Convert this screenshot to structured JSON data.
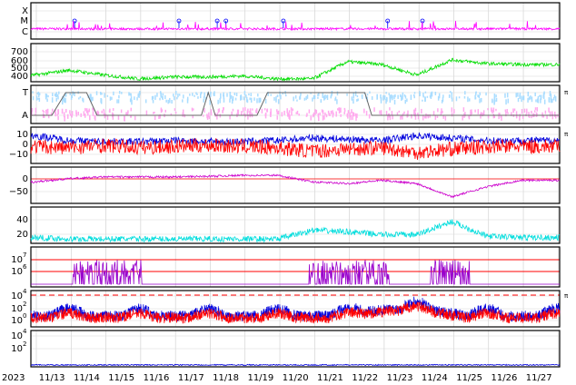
{
  "chart_data": {
    "type": "line",
    "x": [
      "11/13",
      "11/14",
      "11/15",
      "11/16",
      "11/17",
      "11/18",
      "11/19",
      "11/20",
      "11/21",
      "11/22",
      "11/23",
      "11/24",
      "11/25",
      "11/26",
      "11/27"
    ],
    "year_label": "2023",
    "panels": [
      {
        "id": "flare",
        "ytick_labels": [
          "X",
          "M",
          "C"
        ],
        "series": [
          {
            "color": "#ff00ff",
            "level": "C"
          }
        ],
        "markers": {
          "color": "#0000ff",
          "at": [
            "11/14",
            "11/17",
            "11/18",
            "11/18",
            "11/20",
            "11/23",
            "11/24"
          ]
        }
      },
      {
        "id": "solar-wind-speed",
        "ytick_labels": [
          "700",
          "600",
          "500",
          "400"
        ],
        "ylim": [
          350,
          750
        ],
        "series": [
          {
            "color": "#00dd00",
            "values": [
              420,
              470,
              420,
              380,
              400,
              400,
              410,
              380,
              380,
              560,
              530,
              420,
              580,
              540,
              530
            ]
          }
        ]
      },
      {
        "id": "sector",
        "ytick_labels": [
          "T",
          "A"
        ],
        "right_label": "π",
        "series": [
          {
            "color": "#aaddff",
            "name": ""
          },
          {
            "color": "#ffaaee",
            "name": ""
          },
          {
            "color": "#666666",
            "name": ""
          }
        ]
      },
      {
        "id": "imf",
        "ytick_labels": [
          "10",
          "0",
          "−10"
        ],
        "ylim": [
          -15,
          15
        ],
        "right_label": "π",
        "series": [
          {
            "color": "#0000dd",
            "values": [
              8,
              4,
              3,
              3,
              4,
              3,
              3,
              4,
              6,
              5,
              4,
              8,
              6,
              4,
              4
            ]
          },
          {
            "color": "#ff0000",
            "values": [
              -1,
              -2,
              0,
              -2,
              -1,
              0,
              -1,
              -2,
              -5,
              -3,
              -2,
              -6,
              -3,
              -1,
              -1
            ]
          }
        ]
      },
      {
        "id": "dst",
        "ytick_labels": [
          "0",
          "−50"
        ],
        "ylim": [
          -90,
          20
        ],
        "series": [
          {
            "color": "#cc00cc",
            "values": [
              -25,
              -15,
              -10,
              -10,
              -10,
              -8,
              -5,
              -5,
              -25,
              -30,
              -20,
              -30,
              -70,
              -40,
              -20
            ]
          }
        ]
      },
      {
        "id": "kp-like",
        "ytick_labels": [
          "40",
          "20"
        ],
        "ylim": [
          0,
          50
        ],
        "series": [
          {
            "color": "#00dddd",
            "values": [
              8,
              6,
              6,
              6,
              6,
              6,
              6,
              6,
              18,
              16,
              12,
              12,
              30,
              10,
              8
            ]
          }
        ]
      },
      {
        "id": "electron-flux",
        "ytick_labels": [
          "10",
          "10"
        ],
        "ytick_exponents": [
          "7",
          "6"
        ],
        "series": [
          {
            "color": "#9900cc",
            "name": ""
          }
        ],
        "reference_lines": [
          "#ff0000",
          "#ff0000"
        ]
      },
      {
        "id": "proton-flux",
        "ytick_labels": [
          "10",
          "10",
          "10"
        ],
        "ytick_exponents": [
          "4",
          "2",
          "0"
        ],
        "right_label": "π",
        "series": [
          {
            "color": "#0000dd",
            "name": ""
          },
          {
            "color": "#ff0000",
            "name": ""
          }
        ],
        "reference_lines": [
          "#ff0000"
        ]
      },
      {
        "id": "neutron",
        "ytick_labels": [
          "10",
          "10"
        ],
        "ytick_exponents": [
          "4",
          "2"
        ],
        "series": [
          {
            "color": "#0000dd",
            "name": ""
          }
        ]
      }
    ]
  }
}
